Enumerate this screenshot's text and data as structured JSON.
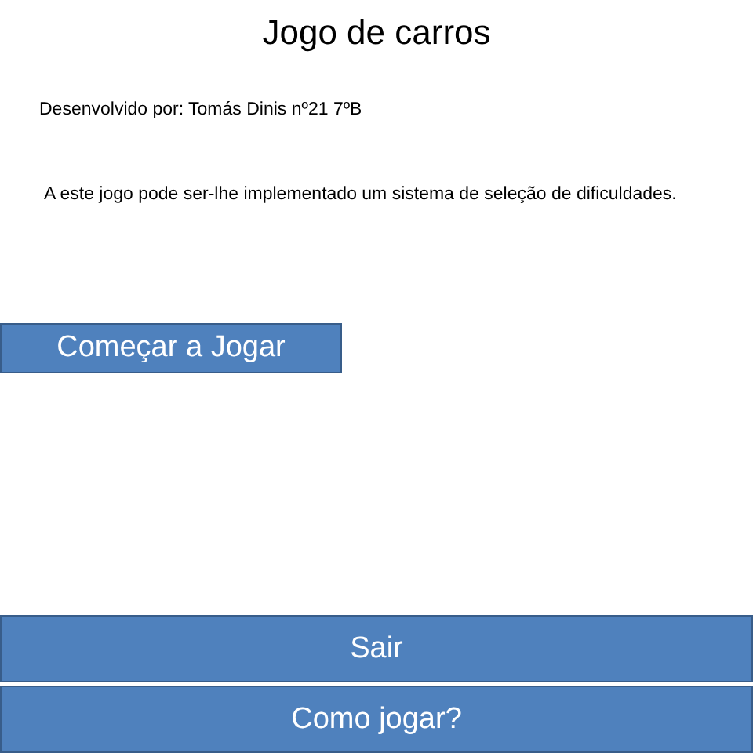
{
  "title": "Jogo de carros",
  "credit": "Desenvolvido por: Tomás Dinis nº21 7ºB",
  "note": "A este jogo pode ser-lhe implementado um sistema de seleção de dificuldades.",
  "start_button": "Começar a Jogar",
  "bottom_buttons": [
    "Sair",
    "Como jogar?"
  ]
}
